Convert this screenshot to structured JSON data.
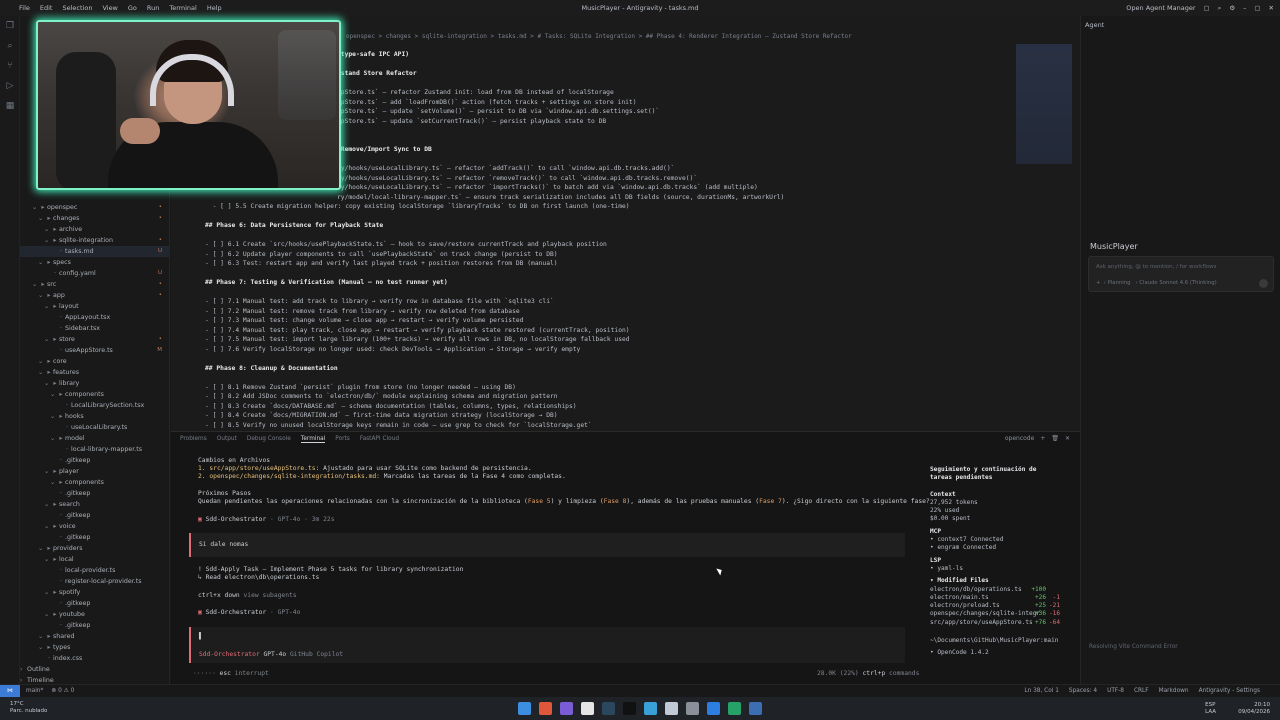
{
  "titlebar": {
    "menu": [
      "File",
      "Edit",
      "Selection",
      "View",
      "Go",
      "Run",
      "Terminal",
      "Help"
    ],
    "title": "MusicPlayer - Antigravity - tasks.md",
    "right_label": "Open Agent Manager"
  },
  "editor": {
    "breadcrumb": "openspec > changes > sqlite-integration > tasks.md > # Tasks: SQLite Integration > ## Phase 4: Renderer Integration — Zustand Store Refactor",
    "lines": [
      {
        "n": "",
        "t": "(type-safe IPC API)",
        "h": true
      },
      {
        "n": "",
        "t": ""
      },
      {
        "n": "",
        "t": "ustand Store Refactor",
        "h": true
      },
      {
        "n": "",
        "t": ""
      },
      {
        "n": "",
        "t": "ppStore.ts` — refactor Zustand init: load from DB instead of localStorage"
      },
      {
        "n": "",
        "t": "ppStore.ts` — add `loadFromDB()` action (fetch tracks + settings on store init)"
      },
      {
        "n": "",
        "t": "ppStore.ts` — update `setVolume()` — persist to DB via `window.api.db.settings.set()`"
      },
      {
        "n": "",
        "t": "ppStore.ts` — update `setCurrentTrack()` — persist playback state to DB"
      },
      {
        "n": "",
        "t": ""
      },
      {
        "n": "",
        "t": ""
      },
      {
        "n": "",
        "t": "/Remove/Import Sync to DB",
        "h": true
      },
      {
        "n": "",
        "t": ""
      },
      {
        "n": "",
        "t": "ry/hooks/useLocalLibrary.ts` — refactor `addTrack()` to call `window.api.db.tracks.add()`"
      },
      {
        "n": "",
        "t": "ry/hooks/useLocalLibrary.ts` — refactor `removeTrack()` to call `window.api.db.tracks.remove()`"
      },
      {
        "n": "",
        "t": "ry/hooks/useLocalLibrary.ts` — refactor `importTracks()` to batch add via `window.api.db.tracks` (add multiple)"
      },
      {
        "n": "",
        "t": "ry/model/local-library-mapper.ts` — ensure track serialization includes all DB fields (source, durationMs, artworkUrl)"
      },
      {
        "n": "",
        "t": "  - [ ] 5.5 Create migration helper: copy existing localStorage `libraryTracks` to DB on first launch (one-time)"
      },
      {
        "n": "",
        "t": ""
      },
      {
        "n": "",
        "t": "## Phase 6: Data Persistence for Playback State",
        "h": true
      },
      {
        "n": "",
        "t": ""
      },
      {
        "n": "",
        "t": "- [ ] 6.1 Create `src/hooks/usePlaybackState.ts` — hook to save/restore currentTrack and playback position"
      },
      {
        "n": "",
        "t": "- [ ] 6.2 Update player components to call `usePlaybackState` on track change (persist to DB)"
      },
      {
        "n": "",
        "t": "- [ ] 6.3 Test: restart app and verify last played track + position restores from DB (manual)"
      },
      {
        "n": "",
        "t": ""
      },
      {
        "n": "",
        "t": "## Phase 7: Testing & Verification (Manual — no test runner yet)",
        "h": true
      },
      {
        "n": "",
        "t": ""
      },
      {
        "n": "",
        "t": "- [ ] 7.1 Manual test: add track to library → verify row in database file with `sqlite3 cli`"
      },
      {
        "n": "",
        "t": "- [ ] 7.2 Manual test: remove track from library → verify row deleted from database"
      },
      {
        "n": "",
        "t": "- [ ] 7.3 Manual test: change volume → close app → restart → verify volume persisted"
      },
      {
        "n": "",
        "t": "- [ ] 7.4 Manual test: play track, close app → restart → verify playback state restored (currentTrack, position)"
      },
      {
        "n": "",
        "t": "- [ ] 7.5 Manual test: import large library (100+ tracks) → verify all rows in DB, no localStorage fallback used"
      },
      {
        "n": "",
        "t": "- [ ] 7.6 Verify localStorage no longer used: check DevTools → Application → Storage → verify empty"
      },
      {
        "n": "",
        "t": ""
      },
      {
        "n": "",
        "t": "## Phase 8: Cleanup & Documentation",
        "h": true
      },
      {
        "n": "",
        "t": ""
      },
      {
        "n": "",
        "t": "- [ ] 8.1 Remove Zustand `persist` plugin from store (no longer needed — using DB)"
      },
      {
        "n": "",
        "t": "- [ ] 8.2 Add JSDoc comments to `electron/db/` module explaining schema and migration pattern"
      },
      {
        "n": "",
        "t": "- [ ] 8.3 Create `docs/DATABASE.md` — schema documentation (tables, columns, types, relationships)"
      },
      {
        "n": "",
        "t": "- [ ] 8.4 Create `docs/MIGRATION.md` — first-time data migration strategy (localStorage → DB)"
      },
      {
        "n": "",
        "t": "- [ ] 8.5 Verify no unused localStorage keys remain in code — use grep to check for `localStorage.get`"
      }
    ]
  },
  "explorer": {
    "rows": [
      {
        "d": 1,
        "t": "openspec",
        "f": true,
        "b": "•"
      },
      {
        "d": 2,
        "t": "changes",
        "f": true,
        "b": "•"
      },
      {
        "d": 3,
        "t": "archive",
        "f": true,
        "b": ""
      },
      {
        "d": 3,
        "t": "sqlite-integration",
        "f": true,
        "b": "•"
      },
      {
        "d": 4,
        "t": "tasks.md",
        "f": false,
        "b": "U",
        "sel": true
      },
      {
        "d": 2,
        "t": "specs",
        "f": true,
        "b": ""
      },
      {
        "d": 3,
        "t": "config.yaml",
        "f": false,
        "b": "U"
      },
      {
        "d": 1,
        "t": "src",
        "f": true,
        "b": "•"
      },
      {
        "d": 2,
        "t": "app",
        "f": true,
        "b": "•"
      },
      {
        "d": 3,
        "t": "layout",
        "f": true,
        "b": ""
      },
      {
        "d": 4,
        "t": "AppLayout.tsx",
        "f": false,
        "b": ""
      },
      {
        "d": 4,
        "t": "Sidebar.tsx",
        "f": false,
        "b": ""
      },
      {
        "d": 3,
        "t": "store",
        "f": true,
        "b": "•"
      },
      {
        "d": 4,
        "t": "useAppStore.ts",
        "f": false,
        "b": "M"
      },
      {
        "d": 2,
        "t": "core",
        "f": true,
        "b": ""
      },
      {
        "d": 2,
        "t": "features",
        "f": true,
        "b": ""
      },
      {
        "d": 3,
        "t": "library",
        "f": true,
        "b": ""
      },
      {
        "d": 4,
        "t": "components",
        "f": true,
        "b": ""
      },
      {
        "d": 5,
        "t": "LocalLibrarySection.tsx",
        "f": false,
        "b": ""
      },
      {
        "d": 4,
        "t": "hooks",
        "f": true,
        "b": ""
      },
      {
        "d": 5,
        "t": "useLocalLibrary.ts",
        "f": false,
        "b": ""
      },
      {
        "d": 4,
        "t": "model",
        "f": true,
        "b": ""
      },
      {
        "d": 5,
        "t": "local-library-mapper.ts",
        "f": false,
        "b": ""
      },
      {
        "d": 4,
        "t": ".gitkeep",
        "f": false,
        "b": ""
      },
      {
        "d": 3,
        "t": "player",
        "f": true,
        "b": ""
      },
      {
        "d": 4,
        "t": "components",
        "f": true,
        "b": ""
      },
      {
        "d": 4,
        "t": ".gitkeep",
        "f": false,
        "b": ""
      },
      {
        "d": 3,
        "t": "search",
        "f": true,
        "b": ""
      },
      {
        "d": 4,
        "t": ".gitkeep",
        "f": false,
        "b": ""
      },
      {
        "d": 3,
        "t": "voice",
        "f": true,
        "b": ""
      },
      {
        "d": 4,
        "t": ".gitkeep",
        "f": false,
        "b": ""
      },
      {
        "d": 2,
        "t": "providers",
        "f": true,
        "b": ""
      },
      {
        "d": 3,
        "t": "local",
        "f": true,
        "b": ""
      },
      {
        "d": 4,
        "t": "local-provider.ts",
        "f": false,
        "b": ""
      },
      {
        "d": 4,
        "t": "register-local-provider.ts",
        "f": false,
        "b": ""
      },
      {
        "d": 3,
        "t": "spotify",
        "f": true,
        "b": ""
      },
      {
        "d": 4,
        "t": ".gitkeep",
        "f": false,
        "b": ""
      },
      {
        "d": 3,
        "t": "youtube",
        "f": true,
        "b": ""
      },
      {
        "d": 4,
        "t": ".gitkeep",
        "f": false,
        "b": ""
      },
      {
        "d": 2,
        "t": "shared",
        "f": true,
        "b": ""
      },
      {
        "d": 2,
        "t": "types",
        "f": true,
        "b": ""
      },
      {
        "d": 2,
        "t": "index.css",
        "f": false,
        "b": ""
      }
    ],
    "outline": "Outline",
    "timeline": "Timeline"
  },
  "panel": {
    "tabs": [
      "Problems",
      "Output",
      "Debug Console",
      "Terminal",
      "Ports",
      "FastAPI Cloud"
    ],
    "active_tab": "Terminal",
    "terminal_name": "opencode",
    "lines": {
      "l1": "Cambios en Archivos",
      "l2a": "1. src/app/store/useAppStore.ts:",
      "l2b": " Ajustado para usar SQLite como backend de persistencia.",
      "l3a": "2. openspec/changes/sqlite-integration/tasks.md:",
      "l3b": " Marcadas las tareas de la Fase 4 como completas.",
      "l4": "Próximos Pasos",
      "l5a": "Quedan pendientes las operaciones relacionadas con la sincronización de la biblioteca (",
      "l5b": "Fase 5",
      "l5c": ") y limpieza (",
      "l5d": "Fase 8",
      "l5e": "), además de las pruebas manuales (",
      "l5f": "Fase 7",
      "l5g": "). ¿Sigo directo con la siguiente fase?",
      "l6a": "Sdd-Orchestrator",
      "l6b": " · GPT-4o · 3m 22s",
      "user": "Si dale nomas",
      "l7": "! Sdd-Apply Task — Implement Phase 5 tasks for library synchronization",
      "l8": "  ↳ Read electron\\db\\operations.ts",
      "l9a": "ctrl+x down",
      "l9b": " view subagents",
      "l10a": "Sdd-Orchestrator",
      "l10b": " · GPT-4o",
      "mode": "Sdd-Orchestrator",
      "model": "GPT-4o",
      "provider": "GitHub Copilot",
      "esc": "esc",
      "interrupt": "interrupt",
      "tokens_pct": "28.0K (22%)",
      "ctrlp": "ctrl+p",
      "commands": "commands"
    },
    "side": {
      "title": "Seguimiento y continuación de tareas pendientes",
      "context": "Context",
      "tokens": "27,952 tokens",
      "used": "22% used",
      "spent": "$0.00 spent",
      "mcp": "MCP",
      "mcp1": "• context7 Connected",
      "mcp2": "• engram Connected",
      "lsp": "LSP",
      "lsp1": "• yaml-ls",
      "mod": "▾ Modified Files",
      "files": [
        {
          "f": "electron/db/operations.ts",
          "a": "+100",
          "r": ""
        },
        {
          "f": "electron/main.ts",
          "a": "+26",
          "r": "-1"
        },
        {
          "f": "electron/preload.ts",
          "a": "+25",
          "r": "-21"
        },
        {
          "f": "openspec/changes/sqlite-integr",
          "a": "+36",
          "r": "-16"
        },
        {
          "f": "src/app/store/useAppStore.ts",
          "a": "+76",
          "r": "-64"
        }
      ],
      "path": "~\\Documents\\GitHub\\MusicPlayer:main",
      "version": "• OpenCode 1.4.2"
    }
  },
  "agent": {
    "header": "Agent",
    "project": "MusicPlayer",
    "placeholder": "Ask anything, @ to mention, / for workflows",
    "planning": "Planning",
    "model": "Claude Sonnet 4.6 (Thinking)",
    "footer": "Resolving Vite Command Error"
  },
  "statusbar": {
    "branch": "main*",
    "problems": "⊗ 0 ⚠ 0",
    "ln": "Ln 38, Col 1",
    "spaces": "Spaces: 4",
    "enc": "UTF-8",
    "eol": "CRLF",
    "lang": "Markdown",
    "app": "Antigravity - Settings"
  },
  "taskbar": {
    "temp": "17°C",
    "weather": "Parc. nublado",
    "lang1": "ESP",
    "lang2": "LAA",
    "time": "20:10",
    "date": "09/04/2026"
  }
}
